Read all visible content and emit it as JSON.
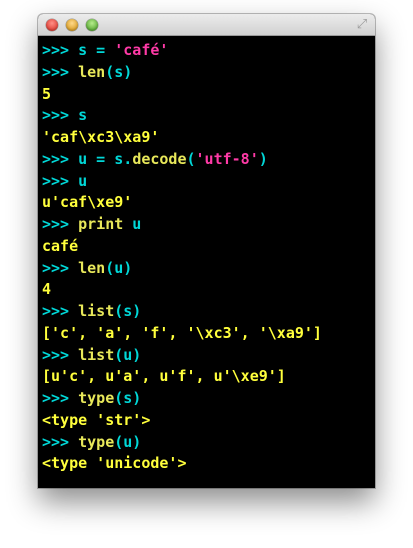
{
  "window": {
    "buttons": [
      "close",
      "minimize",
      "zoom"
    ],
    "resize_icon": "resize-arrows-icon"
  },
  "terminal": {
    "prompt": ">>>",
    "lines": [
      {
        "type": "input",
        "segments": [
          {
            "t": "s = ",
            "c": "code"
          },
          {
            "t": "'café'",
            "c": "str"
          }
        ]
      },
      {
        "type": "input",
        "segments": [
          {
            "t": "len",
            "c": "kw"
          },
          {
            "t": "(s)",
            "c": "code"
          }
        ]
      },
      {
        "type": "output",
        "text": "5"
      },
      {
        "type": "input",
        "segments": [
          {
            "t": "s",
            "c": "code"
          }
        ]
      },
      {
        "type": "output",
        "text": "'caf\\xc3\\xa9'"
      },
      {
        "type": "input",
        "segments": [
          {
            "t": "u = s.",
            "c": "code"
          },
          {
            "t": "decode",
            "c": "kw"
          },
          {
            "t": "(",
            "c": "code"
          },
          {
            "t": "'utf-8'",
            "c": "str"
          },
          {
            "t": ")",
            "c": "code"
          }
        ]
      },
      {
        "type": "input",
        "segments": [
          {
            "t": "u",
            "c": "code"
          }
        ]
      },
      {
        "type": "output",
        "text": "u'caf\\xe9'"
      },
      {
        "type": "input",
        "segments": [
          {
            "t": "print",
            "c": "kw"
          },
          {
            "t": " u",
            "c": "code"
          }
        ]
      },
      {
        "type": "output",
        "text": "café"
      },
      {
        "type": "input",
        "segments": [
          {
            "t": "len",
            "c": "kw"
          },
          {
            "t": "(u)",
            "c": "code"
          }
        ]
      },
      {
        "type": "output",
        "text": "4"
      },
      {
        "type": "input",
        "segments": [
          {
            "t": "list",
            "c": "kw"
          },
          {
            "t": "(s)",
            "c": "code"
          }
        ]
      },
      {
        "type": "output",
        "text": "['c', 'a', 'f', '\\xc3', '\\xa9']"
      },
      {
        "type": "input",
        "segments": [
          {
            "t": "list",
            "c": "kw"
          },
          {
            "t": "(u)",
            "c": "code"
          }
        ]
      },
      {
        "type": "output",
        "text": "[u'c', u'a', u'f', u'\\xe9']"
      },
      {
        "type": "input",
        "segments": [
          {
            "t": "type",
            "c": "kw"
          },
          {
            "t": "(s)",
            "c": "code"
          }
        ]
      },
      {
        "type": "output",
        "text": "<type 'str'>"
      },
      {
        "type": "input",
        "segments": [
          {
            "t": "type",
            "c": "kw"
          },
          {
            "t": "(u)",
            "c": "code"
          }
        ]
      },
      {
        "type": "output",
        "text": "<type 'unicode'>"
      }
    ]
  },
  "colors": {
    "prompt": "#00d7d7",
    "code": "#00d7d7",
    "keyword": "#e8e85a",
    "string": "#ff3aa7",
    "output": "#ffff3c",
    "background": "#000000"
  }
}
